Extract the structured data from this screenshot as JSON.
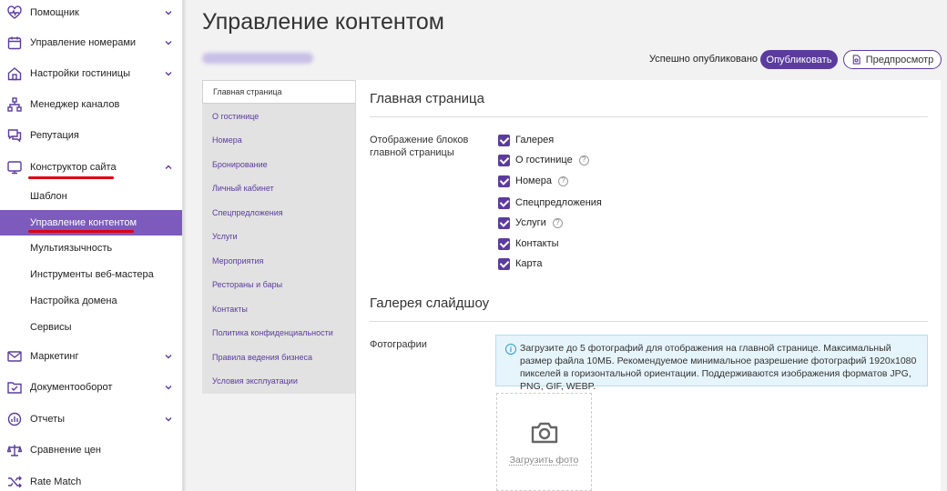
{
  "sidebar": {
    "items": [
      {
        "label": "Помощник",
        "icon": "heart-pulse-icon"
      },
      {
        "label": "Управление номерами",
        "icon": "calendar-icon"
      },
      {
        "label": "Настройки гостиницы",
        "icon": "house-icon"
      },
      {
        "label": "Менеджер каналов",
        "icon": "sitemap-icon"
      },
      {
        "label": "Репутация",
        "icon": "chat-bubbles-icon"
      },
      {
        "label": "Конструктор сайта",
        "icon": "monitor-icon"
      }
    ],
    "subitems": [
      {
        "label": "Шаблон"
      },
      {
        "label": "Управление контентом",
        "active": true
      },
      {
        "label": "Мультиязычность"
      },
      {
        "label": "Инструменты веб-мастера"
      },
      {
        "label": "Настройка домена"
      },
      {
        "label": "Сервисы"
      }
    ],
    "items_bottom": [
      {
        "label": "Маркетинг",
        "icon": "envelope-icon"
      },
      {
        "label": "Документооборот",
        "icon": "folder-check-icon"
      },
      {
        "label": "Отчеты",
        "icon": "chart-circle-icon"
      },
      {
        "label": "Сравнение цен",
        "icon": "scales-icon"
      },
      {
        "label": "Rate Match",
        "icon": "shuffle-icon"
      }
    ]
  },
  "header": {
    "title": "Управление контентом",
    "status": "Успешно опубликовано",
    "publish_label": "Опубликовать",
    "preview_label": "Предпросмотр"
  },
  "tabs": [
    {
      "label": "Главная страница",
      "active": true
    },
    {
      "label": "О гостинице"
    },
    {
      "label": "Номера"
    },
    {
      "label": "Бронирование"
    },
    {
      "label": "Личный кабинет"
    },
    {
      "label": "Спецпредложения"
    },
    {
      "label": "Услуги"
    },
    {
      "label": "Мероприятия"
    },
    {
      "label": "Рестораны и бары"
    },
    {
      "label": "Контакты"
    },
    {
      "label": "Политика конфиденциальности"
    },
    {
      "label": "Правила ведения бизнеса"
    },
    {
      "label": "Условия эксплуатации"
    }
  ],
  "content": {
    "section1_title": "Главная страница",
    "blocks_label": "Отображение блоков главной страницы",
    "checkboxes": [
      {
        "label": "Галерея",
        "checked": true,
        "help": false
      },
      {
        "label": "О гостинице",
        "checked": true,
        "help": true
      },
      {
        "label": "Номера",
        "checked": true,
        "help": true
      },
      {
        "label": "Спецпредложения",
        "checked": true,
        "help": false
      },
      {
        "label": "Услуги",
        "checked": true,
        "help": true
      },
      {
        "label": "Контакты",
        "checked": true,
        "help": false
      },
      {
        "label": "Карта",
        "checked": true,
        "help": false
      }
    ],
    "section2_title": "Галерея слайдшоу",
    "photos_label": "Фотографии",
    "info_text": "Загрузите до 5 фотографий для отображения на главной странице. Максимальный размер файла 10МБ. Рекомендуемое минимальное разрешение фотографий 1920x1080 пикселей в горизонтальной ориентации. Поддерживаются изображения форматов JPG, PNG, GIF, WEBP.",
    "upload_label": "Загрузить фото"
  },
  "colors": {
    "accent": "#5b3c9e",
    "active_menu": "#7c5bbd",
    "underline": "#e00012",
    "info_bg": "#e6f4fb"
  }
}
